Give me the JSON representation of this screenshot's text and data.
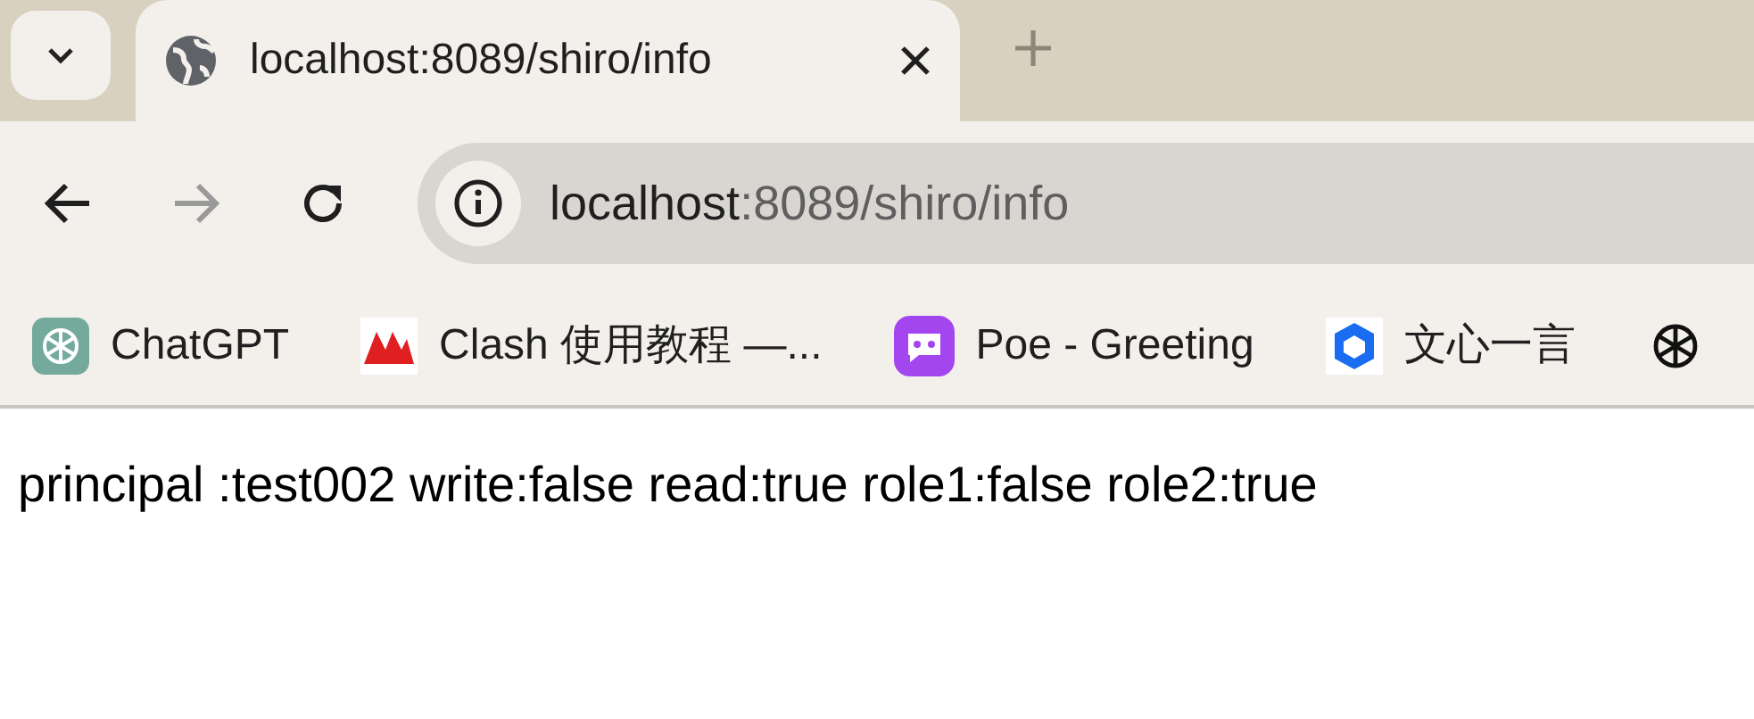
{
  "tab": {
    "title": "localhost:8089/shiro/info",
    "selected": true
  },
  "address": {
    "host": "localhost",
    "path": ":8089/shiro/info"
  },
  "bookmarks": [
    {
      "label": "ChatGPT",
      "kind": "chatgpt"
    },
    {
      "label": "Clash 使用教程 —...",
      "kind": "clash"
    },
    {
      "label": "Poe - Greeting",
      "kind": "poe"
    },
    {
      "label": "文心一言",
      "kind": "wenxin"
    },
    {
      "kind": "openai"
    }
  ],
  "content": "principal :test002 write:false read:true role1:false role2:true"
}
